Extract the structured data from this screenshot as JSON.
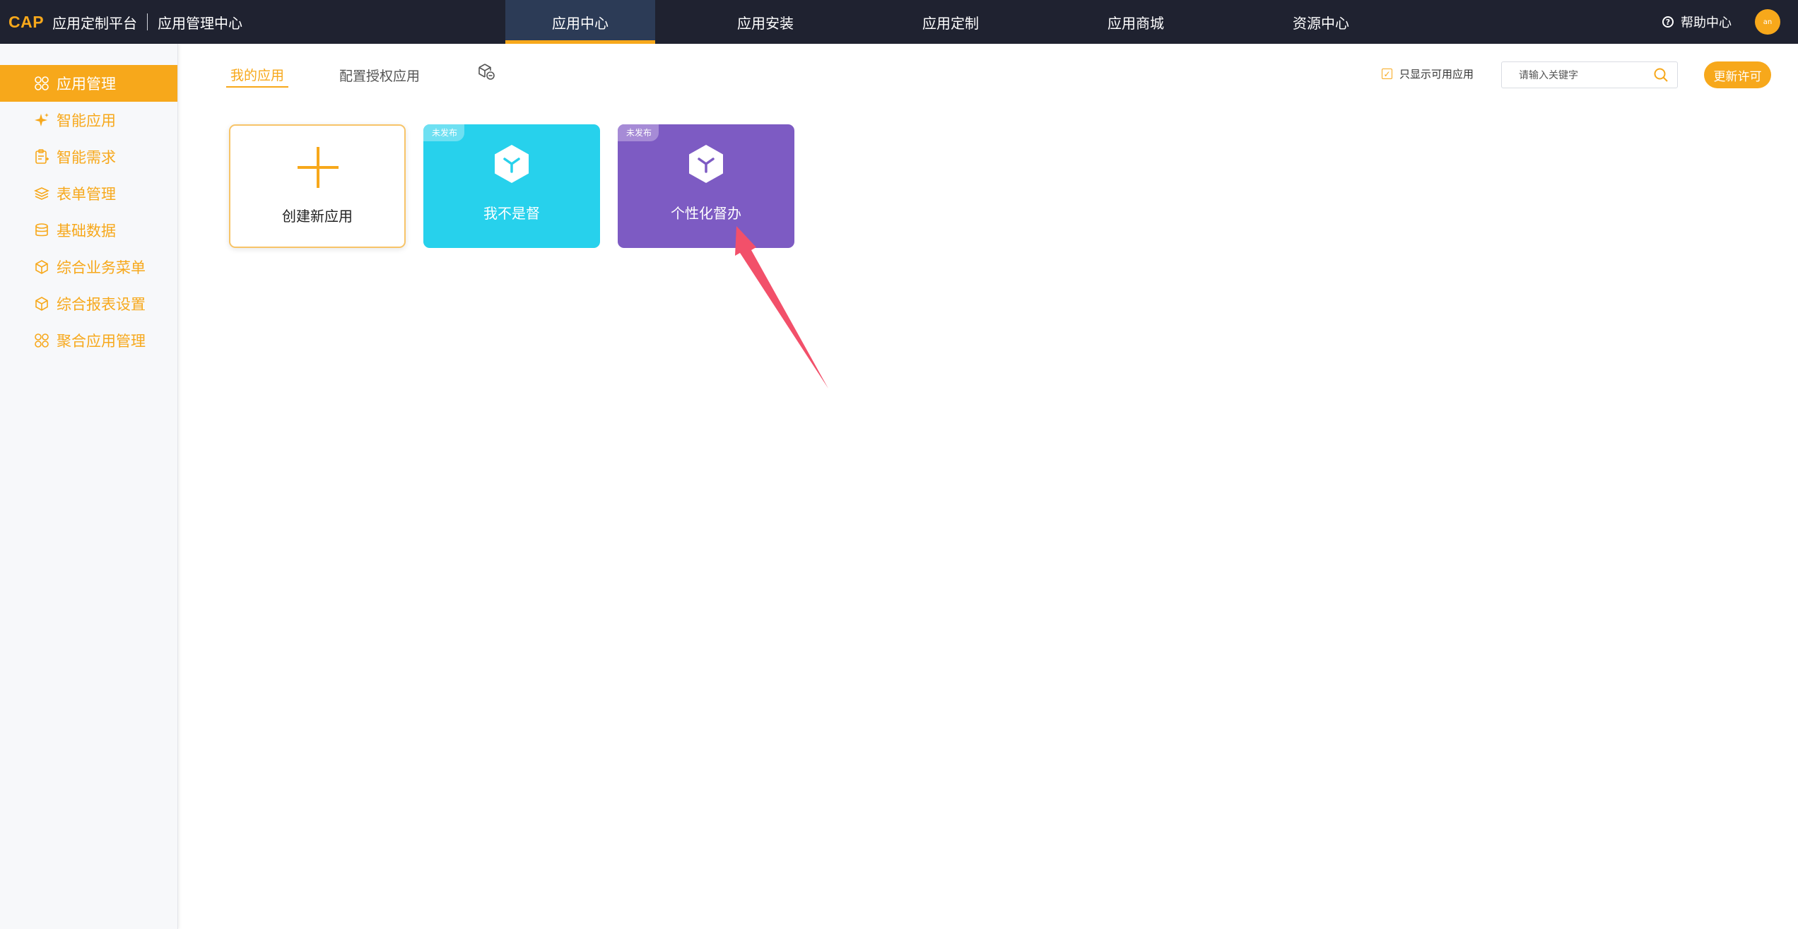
{
  "header": {
    "brand": "CAP",
    "platform": "应用定制平台",
    "center": "应用管理中心",
    "nav": [
      {
        "label": "应用中心",
        "active": true
      },
      {
        "label": "应用安装",
        "active": false
      },
      {
        "label": "应用定制",
        "active": false
      },
      {
        "label": "应用商城",
        "active": false
      },
      {
        "label": "资源中心",
        "active": false
      }
    ],
    "help_label": "帮助中心",
    "avatar_text": "an"
  },
  "sidebar": {
    "items": [
      {
        "label": "应用管理",
        "icon": "grid-icon",
        "active": true
      },
      {
        "label": "智能应用",
        "icon": "sparkle-icon",
        "active": false
      },
      {
        "label": "智能需求",
        "icon": "clipboard-icon",
        "active": false
      },
      {
        "label": "表单管理",
        "icon": "layers-icon",
        "active": false
      },
      {
        "label": "基础数据",
        "icon": "database-icon",
        "active": false
      },
      {
        "label": "综合业务菜单",
        "icon": "cube-icon",
        "active": false
      },
      {
        "label": "综合报表设置",
        "icon": "cube-icon",
        "active": false
      },
      {
        "label": "聚合应用管理",
        "icon": "grid-icon",
        "active": false
      }
    ]
  },
  "main": {
    "tabs": [
      {
        "label": "我的应用",
        "active": true
      },
      {
        "label": "配置授权应用",
        "active": false
      }
    ],
    "filter_label": "只显示可用应用",
    "filter_checked": true,
    "search_placeholder": "请输入关键字",
    "renew_label": "更新许可",
    "create_label": "创建新应用",
    "apps": [
      {
        "name": "我不是督",
        "status": "未发布",
        "color": "#27d1ec"
      },
      {
        "name": "个性化督办",
        "status": "未发布",
        "color": "#7d5bc3"
      }
    ]
  },
  "colors": {
    "accent": "#f7a81b",
    "topbar": "#1f2230",
    "annotation_arrow": "#f2506a"
  }
}
